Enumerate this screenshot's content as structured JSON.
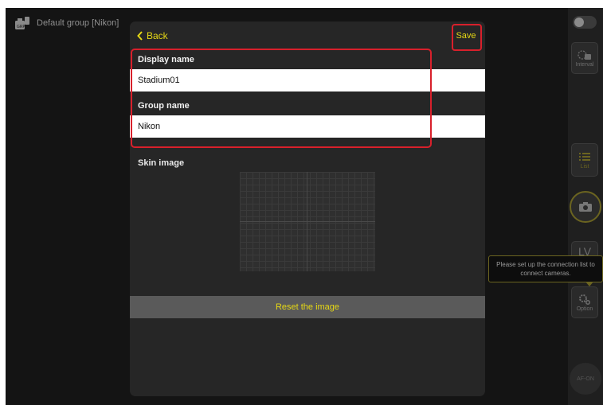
{
  "group_header": {
    "title": "Default group [Nikon]",
    "icon": "camera-group-icon"
  },
  "modal": {
    "back_label": "Back",
    "save_label": "Save",
    "display_name_label": "Display name",
    "display_name_value": "Stadium01",
    "group_name_label": "Group name",
    "group_name_value": "Nikon",
    "skin_image_label": "Skin image",
    "reset_label": "Reset the image"
  },
  "sidebar": {
    "interval_label": "Interval",
    "list_label": "List",
    "lv_label": "LV",
    "option_label": "Option",
    "afon_label": "AF-ON"
  },
  "tooltip": {
    "line1": "Please set up the connection list to",
    "line2": "connect cameras."
  },
  "colors": {
    "accent": "#e6d814",
    "highlight": "#d8202b",
    "background": "#141414"
  }
}
